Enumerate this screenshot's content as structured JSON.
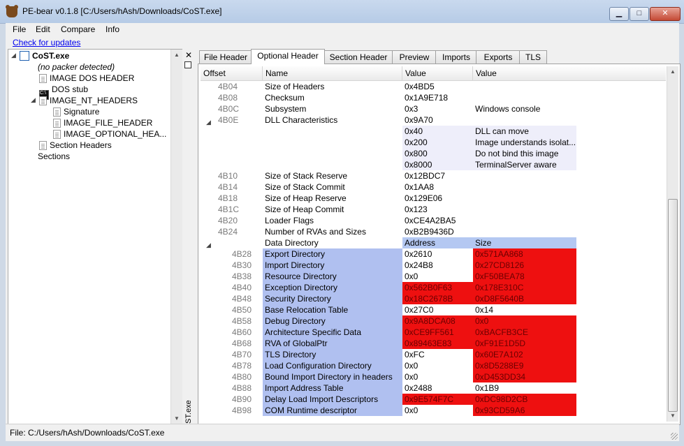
{
  "window": {
    "title": "PE-bear v0.1.8 [C:/Users/hAsh/Downloads/CoST.exe]"
  },
  "menu": [
    "File",
    "Edit",
    "Compare",
    "Info"
  ],
  "toolbar": {
    "updates_link": "Check for updates"
  },
  "tree": {
    "root": "CoST.exe",
    "packer": "(no packer detected)",
    "items": {
      "dos_header": "IMAGE DOS HEADER",
      "dos_stub": "DOS stub",
      "nt_headers": "IMAGE_NT_HEADERS",
      "signature": "Signature",
      "file_header": "IMAGE_FILE_HEADER",
      "optional_header": "IMAGE_OPTIONAL_HEA...",
      "section_headers": "Section Headers",
      "sections": "Sections"
    }
  },
  "side_strip": {
    "title": "CoST.exe",
    "close_glyph": "✕"
  },
  "tabs": [
    "File Header",
    "Optional Header",
    "Section Header",
    "Preview",
    "Imports",
    "Exports",
    "TLS"
  ],
  "active_tab": "Optional Header",
  "columns": [
    "Offset",
    "Name",
    "Value",
    "Value"
  ],
  "rows_top": [
    {
      "offset": "4B04",
      "name": "Size of Headers",
      "value": "0x4BD5",
      "desc": ""
    },
    {
      "offset": "4B08",
      "name": "Checksum",
      "value": "0x1A9E718",
      "desc": ""
    },
    {
      "offset": "4B0C",
      "name": "Subsystem",
      "value": "0x3",
      "desc": "Windows console"
    },
    {
      "offset": "4B0E",
      "name": "DLL Characteristics",
      "value": "0x9A70",
      "desc": ""
    }
  ],
  "dll_flags": [
    {
      "value": "0x40",
      "desc": "DLL can move"
    },
    {
      "value": "0x200",
      "desc": "Image understands isolat..."
    },
    {
      "value": "0x800",
      "desc": "Do not bind this image"
    },
    {
      "value": "0x8000",
      "desc": "TerminalServer aware"
    }
  ],
  "rows_mid": [
    {
      "offset": "4B10",
      "name": "Size of Stack Reserve",
      "value": "0x12BDC7"
    },
    {
      "offset": "4B14",
      "name": "Size of Stack Commit",
      "value": "0x1AA8"
    },
    {
      "offset": "4B18",
      "name": "Size of Heap Reserve",
      "value": "0x129E06"
    },
    {
      "offset": "4B1C",
      "name": "Size of Heap Commit",
      "value": "0x123"
    },
    {
      "offset": "4B20",
      "name": "Loader Flags",
      "value": "0xCE4A2BA5"
    },
    {
      "offset": "4B24",
      "name": "Number of RVAs and Sizes",
      "value": "0xB2B9436D"
    }
  ],
  "data_directory": {
    "label": "Data Directory",
    "col_address": "Address",
    "col_size": "Size",
    "entries": [
      {
        "offset": "4B28",
        "name": "Export Directory",
        "address": "0x2610",
        "size": "0x571AA868",
        "addr_bad": false,
        "size_bad": true
      },
      {
        "offset": "4B30",
        "name": "Import Directory",
        "address": "0x24B8",
        "size": "0x27CD8126",
        "addr_bad": false,
        "size_bad": true
      },
      {
        "offset": "4B38",
        "name": "Resource Directory",
        "address": "0x0",
        "size": "0xF50BEA78",
        "addr_bad": false,
        "size_bad": true
      },
      {
        "offset": "4B40",
        "name": "Exception Directory",
        "address": "0x562B0F63",
        "size": "0x178E310C",
        "addr_bad": true,
        "size_bad": true
      },
      {
        "offset": "4B48",
        "name": "Security Directory",
        "address": "0x18C2678B",
        "size": "0xD8F5640B",
        "addr_bad": true,
        "size_bad": true
      },
      {
        "offset": "4B50",
        "name": "Base Relocation Table",
        "address": "0x27C0",
        "size": "0x14",
        "addr_bad": false,
        "size_bad": false
      },
      {
        "offset": "4B58",
        "name": "Debug Directory",
        "address": "0x9A8DCA08",
        "size": "0x0",
        "addr_bad": true,
        "size_bad": true
      },
      {
        "offset": "4B60",
        "name": "Architecture Specific Data",
        "address": "0xCE9FF561",
        "size": "0xBACFB3CE",
        "addr_bad": true,
        "size_bad": true
      },
      {
        "offset": "4B68",
        "name": "RVA of GlobalPtr",
        "address": "0x89463E83",
        "size": "0xF91E1D5D",
        "addr_bad": true,
        "size_bad": true
      },
      {
        "offset": "4B70",
        "name": "TLS Directory",
        "address": "0xFC",
        "size": "0x60E7A102",
        "addr_bad": false,
        "size_bad": true
      },
      {
        "offset": "4B78",
        "name": "Load Configuration Directory",
        "address": "0x0",
        "size": "0x8D5288E9",
        "addr_bad": false,
        "size_bad": true
      },
      {
        "offset": "4B80",
        "name": "Bound Import Directory in headers",
        "address": "0x0",
        "size": "0xD453DD34",
        "addr_bad": false,
        "size_bad": true
      },
      {
        "offset": "4B88",
        "name": "Import Address Table",
        "address": "0x2488",
        "size": "0x1B9",
        "addr_bad": false,
        "size_bad": false
      },
      {
        "offset": "4B90",
        "name": "Delay Load Import Descriptors",
        "address": "0x9E574F7C",
        "size": "0xDC98D2CB",
        "addr_bad": true,
        "size_bad": true
      },
      {
        "offset": "4B98",
        "name": "COM Runtime descriptor",
        "address": "0x0",
        "size": "0x93CD59A6",
        "addr_bad": false,
        "size_bad": true
      }
    ]
  },
  "status": {
    "text": "File: C:/Users/hAsh/Downloads/CoST.exe"
  },
  "colors": {
    "invalid": "#ee1010",
    "directory_name": "#b0c0f0",
    "flags_bg": "#eeeefa"
  }
}
